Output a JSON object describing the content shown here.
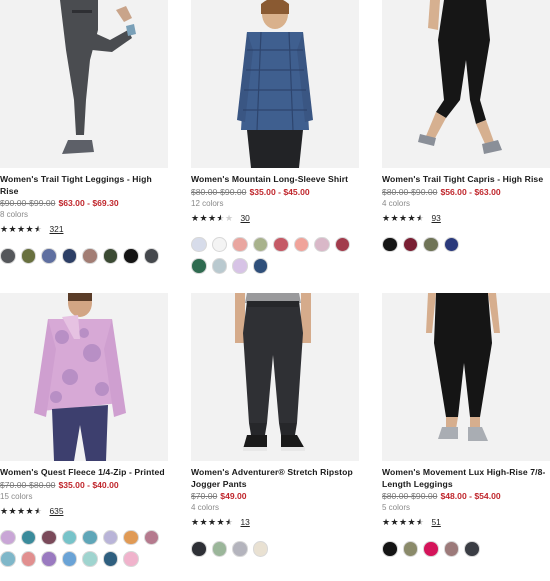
{
  "products": [
    {
      "name": "Women's Trail Tight Leggings - High Rise",
      "price_original": "$90.00-$99.00",
      "price_sale": "$63.00 - $69.30",
      "colors_label": "8 colors",
      "rating": 4.5,
      "review_count": "321",
      "swatches": [
        "#55575b",
        "#68703f",
        "#5f6fa0",
        "#2d3f66",
        "#a27d74",
        "#3b4a33",
        "#141414",
        "#45484d"
      ]
    },
    {
      "name": "Women's Mountain Long-Sleeve Shirt",
      "price_original": "$80.00-$90.00",
      "price_sale": "$35.00 - $45.00",
      "colors_label": "12 colors",
      "rating": 3.5,
      "review_count": "30",
      "swatches": [
        "#d7dcea",
        "#f4f4f4",
        "#e9a6a0",
        "#a8b28c",
        "#c55a66",
        "#f0a39a",
        "#d9b8c8",
        "#a23b4c",
        "#2f6b50",
        "#b9c9cf",
        "#d7c3e6",
        "#2f4f7a"
      ]
    },
    {
      "name": "Women's Trail Tight Capris - High Rise",
      "price_original": "$80.00-$90.00",
      "price_sale": "$56.00 - $63.00",
      "colors_label": "4 colors",
      "rating": 4.5,
      "review_count": "93",
      "swatches": [
        "#151515",
        "#7a1f33",
        "#6f7457",
        "#2b3a7c"
      ]
    },
    {
      "name": "Women's Quest Fleece 1/4-Zip - Printed",
      "price_original": "$70.00-$80.00",
      "price_sale": "$35.00 - $40.00",
      "colors_label": "15 colors",
      "rating": 4.5,
      "review_count": "635",
      "swatches": [
        "#c9a6d6",
        "#3b8b9b",
        "#7a4a5a",
        "#77c3c9",
        "#5fa6b8",
        "#b9b4d8",
        "#e09a55",
        "#b57a8e",
        "#7fb7c9",
        "#e18f8f",
        "#9a7ac0",
        "#6aa3d6",
        "#9fd4cf",
        "#2f5f7f",
        "#f0b3cc"
      ]
    },
    {
      "name": "Women's Adventurer® Stretch Ripstop Jogger Pants",
      "price_original": "$70.00",
      "price_sale": "$49.00",
      "colors_label": "4 colors",
      "rating": 4.5,
      "review_count": "13",
      "swatches": [
        "#2e3036",
        "#9bb69a",
        "#b4b4bd",
        "#e9e1d2"
      ]
    },
    {
      "name": "Women's Movement Lux High-Rise 7/8-Length Leggings",
      "price_original": "$80.00-$90.00",
      "price_sale": "$48.00 - $54.00",
      "colors_label": "5 colors",
      "rating": 4.5,
      "review_count": "51",
      "swatches": [
        "#141414",
        "#8a8a6a",
        "#d4145a",
        "#9c7a7a",
        "#3a3d44"
      ]
    }
  ]
}
